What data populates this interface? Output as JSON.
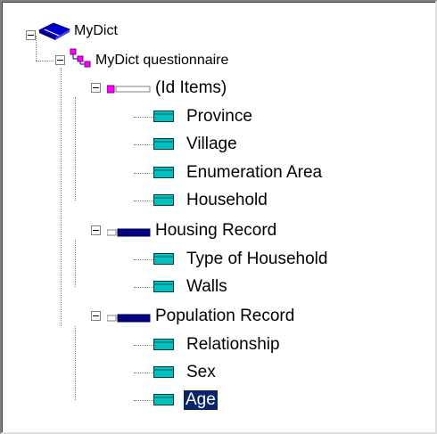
{
  "tree": {
    "root": {
      "label": "MyDict",
      "icon": "dictionary-book-icon"
    },
    "questionnaire": {
      "label": "MyDict questionnaire",
      "icon": "level-hierarchy-icon"
    },
    "records": [
      {
        "label": "(Id Items)",
        "icon": "id-items-record-icon",
        "items": [
          "Province",
          "Village",
          "Enumeration Area",
          "Household"
        ]
      },
      {
        "label": "Housing Record",
        "icon": "record-icon",
        "items": [
          "Type of Household",
          "Walls"
        ]
      },
      {
        "label": "Population Record",
        "icon": "record-icon",
        "items": [
          "Relationship",
          "Sex",
          "Age"
        ]
      }
    ],
    "item_icon": "item-icon",
    "selected_item": "Age"
  },
  "colors": {
    "item_icon_fill": "#00c0c0",
    "record_icon_fill": "#000080",
    "id_record_icon_fill": "#ff00ff",
    "selection_bg": "#0a246a"
  }
}
